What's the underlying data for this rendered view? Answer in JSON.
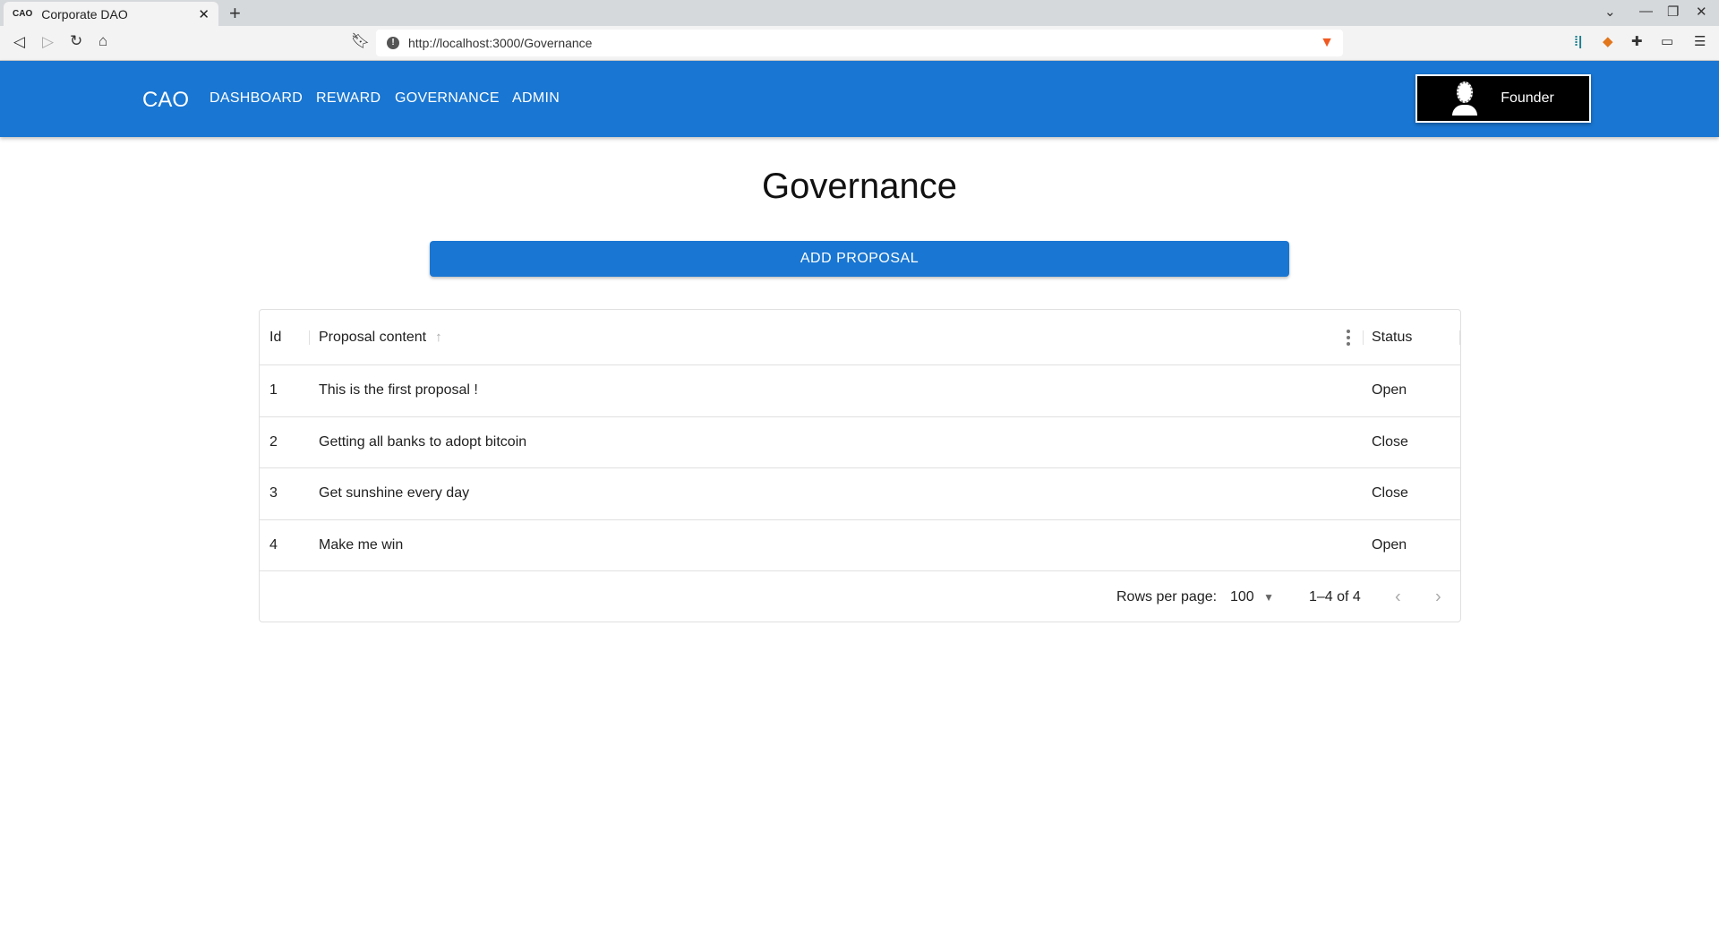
{
  "browser": {
    "tab_title": "Corporate DAO",
    "favicon_text": "CAO",
    "url": "http://localhost:3000/Governance"
  },
  "app": {
    "logo": "CAO",
    "nav": [
      "DASHBOARD",
      "REWARD",
      "GOVERNANCE",
      "ADMIN"
    ],
    "account_label": "Founder",
    "brand_color": "#1976d2"
  },
  "page": {
    "title": "Governance",
    "add_button": "ADD PROPOSAL"
  },
  "table": {
    "columns": [
      "Id",
      "Proposal content",
      "Status"
    ],
    "sort": {
      "column": "Proposal content",
      "direction": "ascending"
    },
    "rows": [
      {
        "id": "1",
        "content": "This is the first proposal !",
        "status": "Open"
      },
      {
        "id": "2",
        "content": "Getting all banks to adopt bitcoin",
        "status": "Close"
      },
      {
        "id": "3",
        "content": "Get sunshine every day",
        "status": "Close"
      },
      {
        "id": "4",
        "content": "Make me win",
        "status": "Open"
      }
    ],
    "footer": {
      "rows_per_page_label": "Rows per page:",
      "rows_per_page": "100",
      "range": "1–4 of 4"
    }
  }
}
